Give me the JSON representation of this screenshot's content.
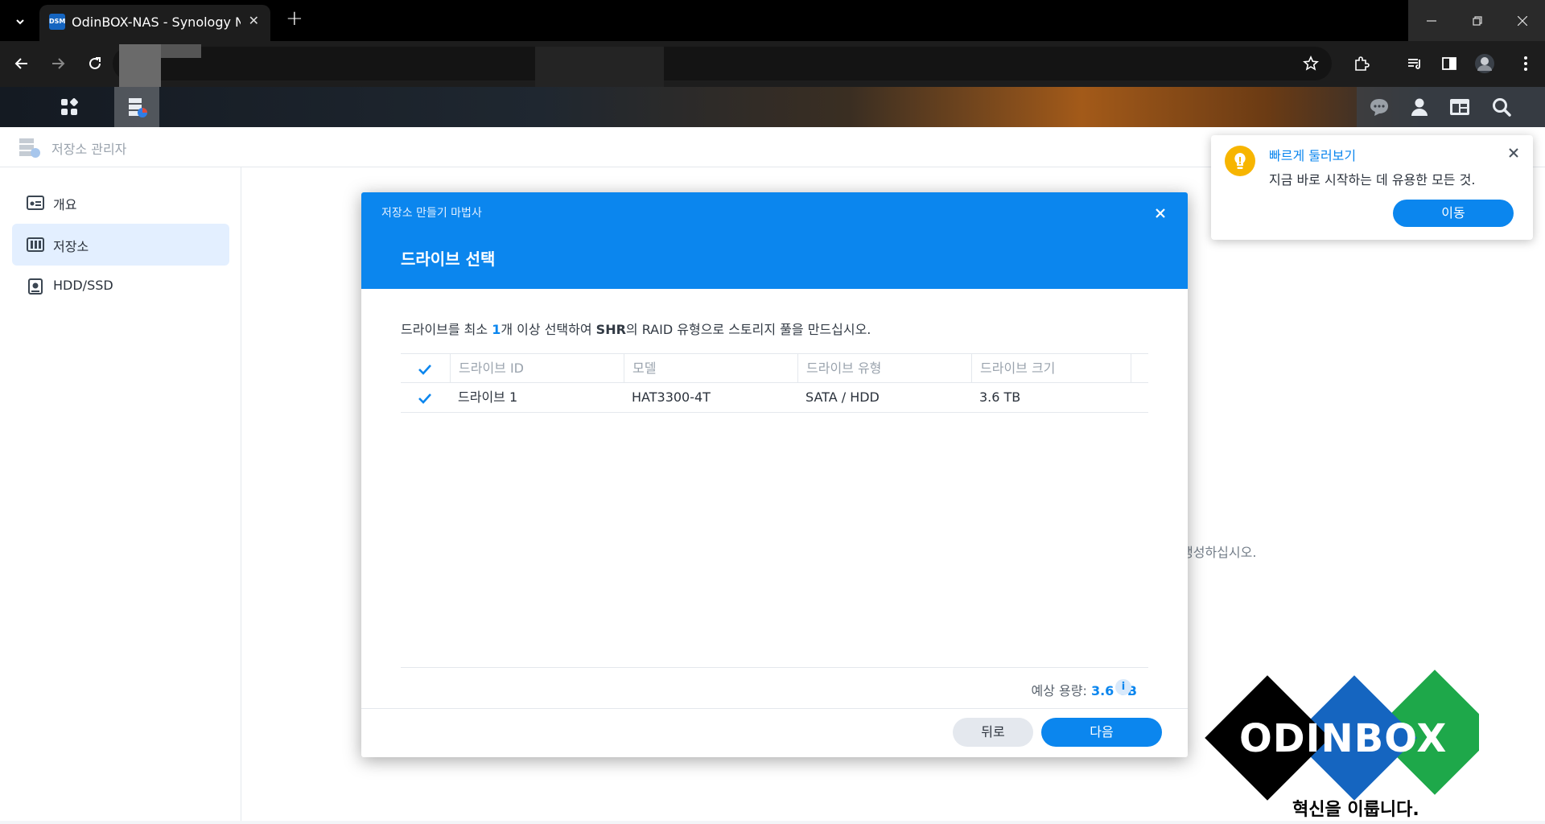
{
  "browser": {
    "tab_title": "OdinBOX-NAS - Synology NAS",
    "favicon_text": "DSM"
  },
  "app": {
    "title": "저장소 관리자",
    "sidebar": [
      {
        "label": "개요",
        "icon": "overview-icon"
      },
      {
        "label": "저장소",
        "icon": "storage-icon"
      },
      {
        "label": "HDD/SSD",
        "icon": "drive-icon"
      }
    ],
    "background_hint": "생성하십시오."
  },
  "wizard": {
    "title": "저장소 만들기 마법사",
    "step": "드라이브 선택",
    "desc_pre": "드라이브를 최소 ",
    "desc_num": "1",
    "desc_mid": "개 이상 선택하여 ",
    "desc_bold": "SHR",
    "desc_post": "의 RAID 유형으로 스토리지 풀을 만드십시오.",
    "columns": [
      "드라이브 ID",
      "모델",
      "드라이브 유형",
      "드라이브 크기"
    ],
    "rows": [
      {
        "id": "드라이브 1",
        "model": "HAT3300-4T",
        "type": "SATA / HDD",
        "size": "3.6 TB",
        "checked": true
      }
    ],
    "capacity_label": "예상 용량: ",
    "capacity_value": "3.6 TB",
    "info_glyph": "i",
    "back_label": "뒤로",
    "next_label": "다음"
  },
  "tour": {
    "title": "빠르게 둘러보기",
    "desc": "지금 바로 시작하는 데 유용한 모든 것.",
    "button": "이동"
  },
  "watermark": {
    "brand": "ODINBOX",
    "tagline": "혁신을 이룹니다."
  },
  "colors": {
    "accent": "#0b86ee",
    "tour_icon": "#f7b500"
  }
}
